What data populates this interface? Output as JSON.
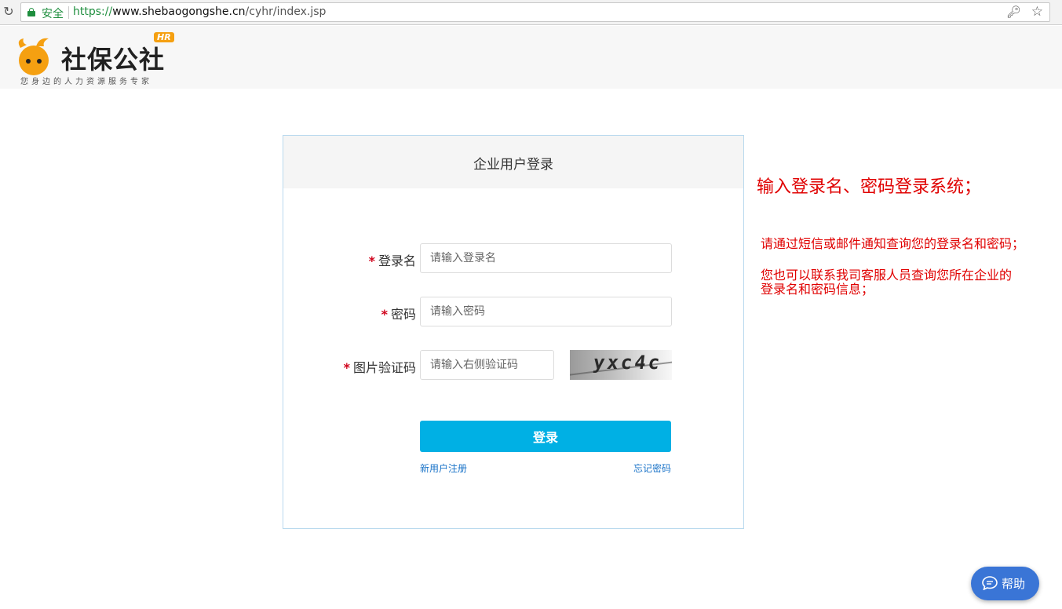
{
  "browser": {
    "secure_label": "安全",
    "url_scheme": "https://",
    "url_host": "www.shebaogongshe.cn",
    "url_path": "/cyhr/index.jsp"
  },
  "header": {
    "logo_name": "社保公社",
    "logo_badge": "HR",
    "slogan": "您身边的人力资源服务专家",
    "brand_color": "#f5a011"
  },
  "login": {
    "title": "企业用户登录",
    "required_mark": "*",
    "username_label": "登录名",
    "username_placeholder": "请输入登录名",
    "password_label": "密码",
    "password_placeholder": "请输入密码",
    "captcha_label": "图片验证码",
    "captcha_placeholder": "请输入右侧验证码",
    "captcha_text": "yxc4c",
    "submit_label": "登录",
    "register_link": "新用户注册",
    "forgot_link": "忘记密码",
    "accent_color": "#00b0e4"
  },
  "annotations": {
    "line1": "输入登录名、密码登录系统；",
    "line2": "请通过短信或邮件通知查询您的登录名和密码；",
    "line3a": "您也可以联系我司客服人员查询您所在企业的",
    "line3b": "登录名和密码信息；",
    "color": "#e00000"
  },
  "help": {
    "label": "帮助"
  }
}
